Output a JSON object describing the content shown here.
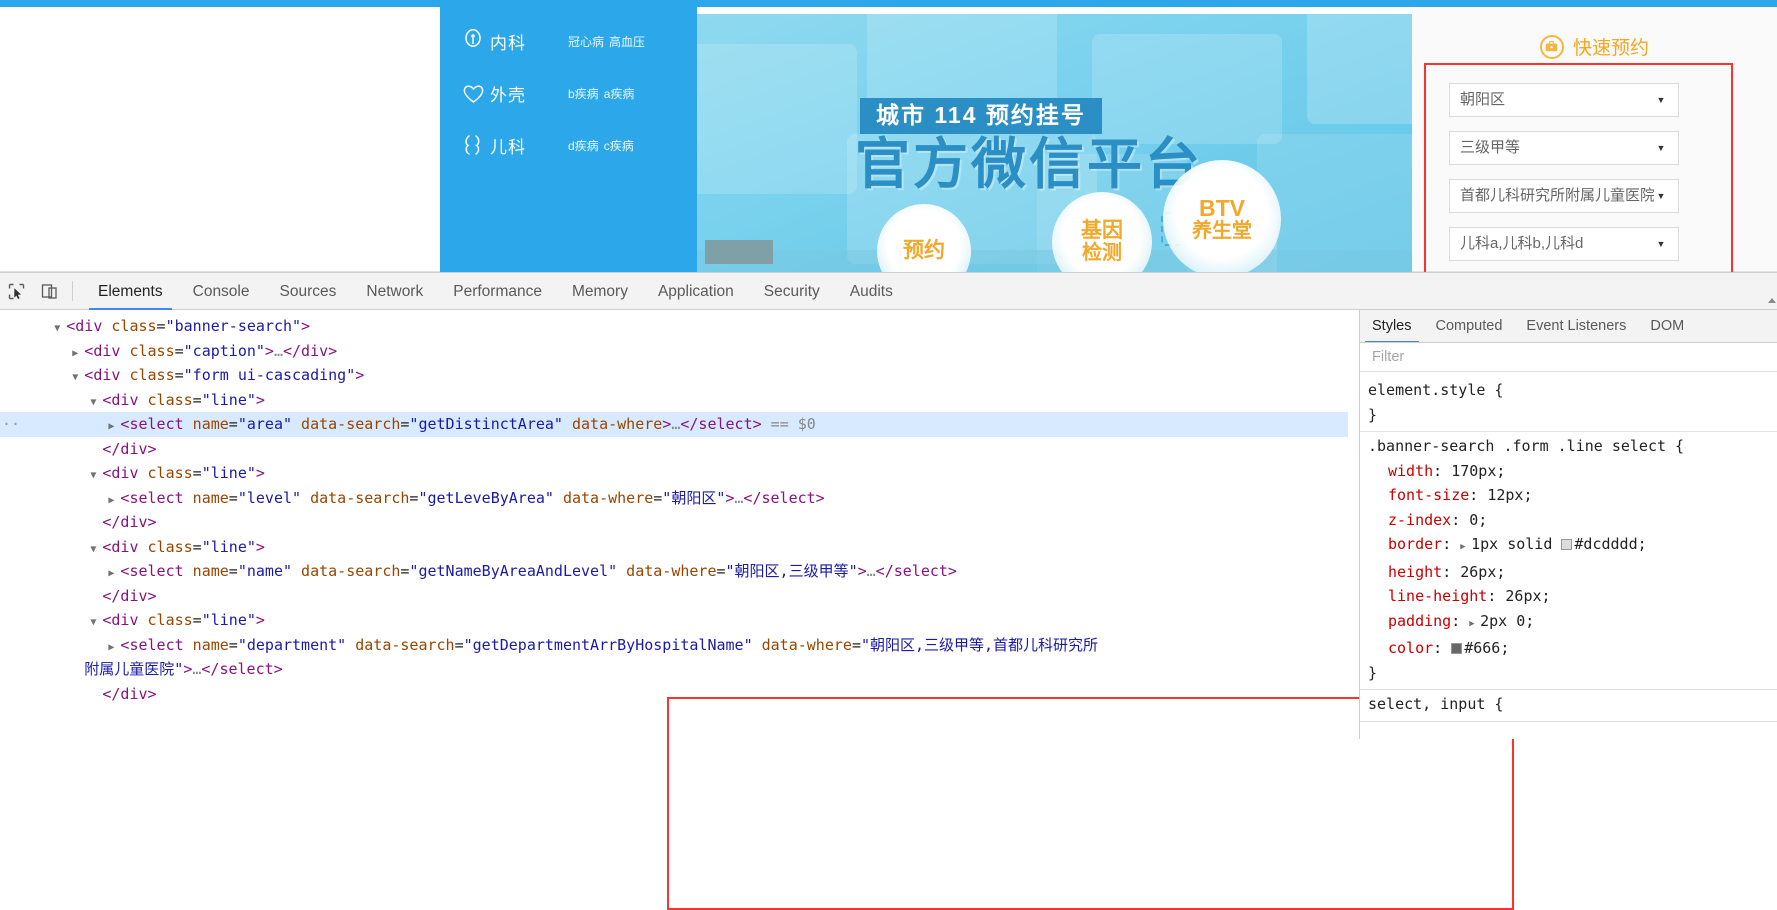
{
  "page": {
    "departments": [
      {
        "icon": "stethoscope-icon",
        "name": "内科",
        "tags": [
          "冠心病",
          "高血压"
        ]
      },
      {
        "icon": "heart-icon",
        "name": "外壳",
        "tags": [
          "b疾病",
          "a疾病"
        ]
      },
      {
        "icon": "pulse-icon",
        "name": "儿科",
        "tags": [
          "d疾病",
          "c疾病"
        ]
      }
    ],
    "banner": {
      "tag_label": "城市 114 预约挂号",
      "headline": "官方微信平台",
      "bubbles": [
        {
          "name": "bubble-yuyue",
          "line1": "预约"
        },
        {
          "name": "bubble-jiyin",
          "line1": "基因",
          "line2": "检测"
        },
        {
          "name": "bubble-btv",
          "line1": "BTV",
          "line2": "养生堂"
        }
      ]
    },
    "quick_book": {
      "title": "快速预约",
      "title_icon": "briefcase-icon",
      "accent_color": "#f5a623",
      "highlight_color": "#f5352e",
      "selects": [
        {
          "name": "area",
          "value": "朝阳区"
        },
        {
          "name": "level",
          "value": "三级甲等"
        },
        {
          "name": "hospital-name",
          "value": "首都儿科研究所附属儿童医院"
        },
        {
          "name": "department",
          "value": "儿科a,儿科b,儿科d"
        }
      ],
      "caret_glyph": "▼"
    }
  },
  "devtools": {
    "toolbar": {
      "inspect_icon": "inspect-cursor-icon",
      "device_icon": "device-toolbar-icon",
      "tabs": [
        "Elements",
        "Console",
        "Sources",
        "Network",
        "Performance",
        "Memory",
        "Application",
        "Security",
        "Audits"
      ],
      "active_tab": "Elements"
    },
    "dom_tree": [
      {
        "indent": 2,
        "triangle": "▼",
        "selected": false,
        "gutter": "",
        "parts": [
          {
            "t": "punc",
            "s": "<"
          },
          {
            "t": "tag",
            "s": "div"
          },
          {
            "t": "sp",
            "s": " "
          },
          {
            "t": "attr",
            "s": "class"
          },
          {
            "t": "eq",
            "s": "="
          },
          {
            "t": "val",
            "s": "\"banner-search\""
          },
          {
            "t": "punc",
            "s": ">"
          }
        ]
      },
      {
        "indent": 3,
        "triangle": "▶",
        "selected": false,
        "gutter": "",
        "parts": [
          {
            "t": "punc",
            "s": "<"
          },
          {
            "t": "tag",
            "s": "div"
          },
          {
            "t": "sp",
            "s": " "
          },
          {
            "t": "attr",
            "s": "class"
          },
          {
            "t": "eq",
            "s": "="
          },
          {
            "t": "val",
            "s": "\"caption\""
          },
          {
            "t": "punc",
            "s": ">"
          },
          {
            "t": "gray",
            "s": "…"
          },
          {
            "t": "punc",
            "s": "</"
          },
          {
            "t": "tag",
            "s": "div"
          },
          {
            "t": "punc",
            "s": ">"
          }
        ]
      },
      {
        "indent": 3,
        "triangle": "▼",
        "selected": false,
        "gutter": "",
        "parts": [
          {
            "t": "punc",
            "s": "<"
          },
          {
            "t": "tag",
            "s": "div"
          },
          {
            "t": "sp",
            "s": " "
          },
          {
            "t": "attr",
            "s": "class"
          },
          {
            "t": "eq",
            "s": "="
          },
          {
            "t": "val",
            "s": "\"form ui-cascading\""
          },
          {
            "t": "punc",
            "s": ">"
          }
        ]
      },
      {
        "indent": 4,
        "triangle": "▼",
        "selected": false,
        "gutter": "",
        "parts": [
          {
            "t": "punc",
            "s": "<"
          },
          {
            "t": "tag",
            "s": "div"
          },
          {
            "t": "sp",
            "s": " "
          },
          {
            "t": "attr",
            "s": "class"
          },
          {
            "t": "eq",
            "s": "="
          },
          {
            "t": "val",
            "s": "\"line\""
          },
          {
            "t": "punc",
            "s": ">"
          }
        ]
      },
      {
        "indent": 5,
        "triangle": "▶",
        "selected": true,
        "gutter": "··",
        "parts": [
          {
            "t": "punc",
            "s": "<"
          },
          {
            "t": "tag",
            "s": "select"
          },
          {
            "t": "sp",
            "s": " "
          },
          {
            "t": "attr",
            "s": "name"
          },
          {
            "t": "eq",
            "s": "="
          },
          {
            "t": "val",
            "s": "\"area\""
          },
          {
            "t": "sp",
            "s": " "
          },
          {
            "t": "attr",
            "s": "data-search"
          },
          {
            "t": "eq",
            "s": "="
          },
          {
            "t": "val",
            "s": "\"getDistinctArea\""
          },
          {
            "t": "sp",
            "s": " "
          },
          {
            "t": "attr",
            "s": "data-where"
          },
          {
            "t": "punc",
            "s": ">"
          },
          {
            "t": "gray",
            "s": "…"
          },
          {
            "t": "punc",
            "s": "</"
          },
          {
            "t": "tag",
            "s": "select"
          },
          {
            "t": "punc",
            "s": ">"
          },
          {
            "t": "sp",
            "s": " "
          },
          {
            "t": "gray",
            "s": "== $0"
          }
        ]
      },
      {
        "indent": 4,
        "triangle": "",
        "selected": false,
        "gutter": "",
        "parts": [
          {
            "t": "punc",
            "s": "</"
          },
          {
            "t": "tag",
            "s": "div"
          },
          {
            "t": "punc",
            "s": ">"
          }
        ]
      },
      {
        "indent": 4,
        "triangle": "▼",
        "selected": false,
        "gutter": "",
        "parts": [
          {
            "t": "punc",
            "s": "<"
          },
          {
            "t": "tag",
            "s": "div"
          },
          {
            "t": "sp",
            "s": " "
          },
          {
            "t": "attr",
            "s": "class"
          },
          {
            "t": "eq",
            "s": "="
          },
          {
            "t": "val",
            "s": "\"line\""
          },
          {
            "t": "punc",
            "s": ">"
          }
        ]
      },
      {
        "indent": 5,
        "triangle": "▶",
        "selected": false,
        "gutter": "",
        "parts": [
          {
            "t": "punc",
            "s": "<"
          },
          {
            "t": "tag",
            "s": "select"
          },
          {
            "t": "sp",
            "s": " "
          },
          {
            "t": "attr",
            "s": "name"
          },
          {
            "t": "eq",
            "s": "="
          },
          {
            "t": "val",
            "s": "\"level\""
          },
          {
            "t": "sp",
            "s": " "
          },
          {
            "t": "attr",
            "s": "data-search"
          },
          {
            "t": "eq",
            "s": "="
          },
          {
            "t": "val",
            "s": "\"getLeveByArea\""
          },
          {
            "t": "sp",
            "s": " "
          },
          {
            "t": "attr",
            "s": "data-where"
          },
          {
            "t": "eq",
            "s": "="
          },
          {
            "t": "val",
            "s": "\"朝阳区\""
          },
          {
            "t": "punc",
            "s": ">"
          },
          {
            "t": "gray",
            "s": "…"
          },
          {
            "t": "punc",
            "s": "</"
          },
          {
            "t": "tag",
            "s": "select"
          },
          {
            "t": "punc",
            "s": ">"
          }
        ]
      },
      {
        "indent": 4,
        "triangle": "",
        "selected": false,
        "gutter": "",
        "parts": [
          {
            "t": "punc",
            "s": "</"
          },
          {
            "t": "tag",
            "s": "div"
          },
          {
            "t": "punc",
            "s": ">"
          }
        ]
      },
      {
        "indent": 4,
        "triangle": "▼",
        "selected": false,
        "gutter": "",
        "parts": [
          {
            "t": "punc",
            "s": "<"
          },
          {
            "t": "tag",
            "s": "div"
          },
          {
            "t": "sp",
            "s": " "
          },
          {
            "t": "attr",
            "s": "class"
          },
          {
            "t": "eq",
            "s": "="
          },
          {
            "t": "val",
            "s": "\"line\""
          },
          {
            "t": "punc",
            "s": ">"
          }
        ]
      },
      {
        "indent": 5,
        "triangle": "▶",
        "selected": false,
        "gutter": "",
        "parts": [
          {
            "t": "punc",
            "s": "<"
          },
          {
            "t": "tag",
            "s": "select"
          },
          {
            "t": "sp",
            "s": " "
          },
          {
            "t": "attr",
            "s": "name"
          },
          {
            "t": "eq",
            "s": "="
          },
          {
            "t": "val",
            "s": "\"name\""
          },
          {
            "t": "sp",
            "s": " "
          },
          {
            "t": "attr",
            "s": "data-search"
          },
          {
            "t": "eq",
            "s": "="
          },
          {
            "t": "val",
            "s": "\"getNameByAreaAndLevel\""
          },
          {
            "t": "sp",
            "s": " "
          },
          {
            "t": "attr",
            "s": "data-where"
          },
          {
            "t": "eq",
            "s": "="
          },
          {
            "t": "val",
            "s": "\"朝阳区,三级甲等\""
          },
          {
            "t": "punc",
            "s": ">"
          },
          {
            "t": "gray",
            "s": "…"
          },
          {
            "t": "punc",
            "s": "</"
          },
          {
            "t": "tag",
            "s": "select"
          },
          {
            "t": "punc",
            "s": ">"
          }
        ]
      },
      {
        "indent": 4,
        "triangle": "",
        "selected": false,
        "gutter": "",
        "parts": [
          {
            "t": "punc",
            "s": "</"
          },
          {
            "t": "tag",
            "s": "div"
          },
          {
            "t": "punc",
            "s": ">"
          }
        ]
      },
      {
        "indent": 4,
        "triangle": "▼",
        "selected": false,
        "gutter": "",
        "parts": [
          {
            "t": "punc",
            "s": "<"
          },
          {
            "t": "tag",
            "s": "div"
          },
          {
            "t": "sp",
            "s": " "
          },
          {
            "t": "attr",
            "s": "class"
          },
          {
            "t": "eq",
            "s": "="
          },
          {
            "t": "val",
            "s": "\"line\""
          },
          {
            "t": "punc",
            "s": ">"
          }
        ]
      },
      {
        "indent": 5,
        "triangle": "▶",
        "selected": false,
        "gutter": "",
        "parts": [
          {
            "t": "punc",
            "s": "<"
          },
          {
            "t": "tag",
            "s": "select"
          },
          {
            "t": "sp",
            "s": " "
          },
          {
            "t": "attr",
            "s": "name"
          },
          {
            "t": "eq",
            "s": "="
          },
          {
            "t": "val",
            "s": "\"department\""
          },
          {
            "t": "sp",
            "s": " "
          },
          {
            "t": "attr",
            "s": "data-search"
          },
          {
            "t": "eq",
            "s": "="
          },
          {
            "t": "val",
            "s": "\"getDepartmentArrByHospitalName\""
          },
          {
            "t": "sp",
            "s": " "
          },
          {
            "t": "attr",
            "s": "data-where"
          },
          {
            "t": "eq",
            "s": "="
          },
          {
            "t": "val",
            "s": "\"朝阳区,三级甲等,首都儿科研究所"
          }
        ]
      },
      {
        "indent": 3,
        "triangle": "",
        "selected": false,
        "gutter": "",
        "parts": [
          {
            "t": "val",
            "s": "附属儿童医院\""
          },
          {
            "t": "punc",
            "s": ">"
          },
          {
            "t": "gray",
            "s": "…"
          },
          {
            "t": "punc",
            "s": "</"
          },
          {
            "t": "tag",
            "s": "select"
          },
          {
            "t": "punc",
            "s": ">"
          }
        ]
      },
      {
        "indent": 4,
        "triangle": "",
        "selected": false,
        "gutter": "",
        "parts": [
          {
            "t": "punc",
            "s": "</"
          },
          {
            "t": "tag",
            "s": "div"
          },
          {
            "t": "punc",
            "s": ">"
          }
        ]
      }
    ],
    "styles": {
      "tabs": [
        "Styles",
        "Computed",
        "Event Listeners",
        "DOM"
      ],
      "active_tab": "Styles",
      "filter_placeholder": "Filter",
      "rules": [
        {
          "selector": "element.style {",
          "declarations": [],
          "close": "}"
        },
        {
          "selector": ".banner-search .form .line select {",
          "declarations": [
            {
              "prop": "width",
              "value": "170px;",
              "swatch": null,
              "tri": false
            },
            {
              "prop": "font-size",
              "value": "12px;",
              "swatch": null,
              "tri": false
            },
            {
              "prop": "z-index",
              "value": "0;",
              "swatch": null,
              "tri": false
            },
            {
              "prop": "border",
              "value": "1px solid #dcdddd;",
              "swatch": "#dcdddd",
              "tri": true
            },
            {
              "prop": "height",
              "value": "26px;",
              "swatch": null,
              "tri": false
            },
            {
              "prop": "line-height",
              "value": "26px;",
              "swatch": null,
              "tri": false
            },
            {
              "prop": "padding",
              "value": "2px 0;",
              "swatch": null,
              "tri": true
            },
            {
              "prop": "color",
              "value": "#666;",
              "swatch": "#666666",
              "tri": false
            }
          ],
          "close": "}"
        },
        {
          "selector": "select, input {",
          "declarations": [],
          "close": ""
        }
      ]
    }
  }
}
